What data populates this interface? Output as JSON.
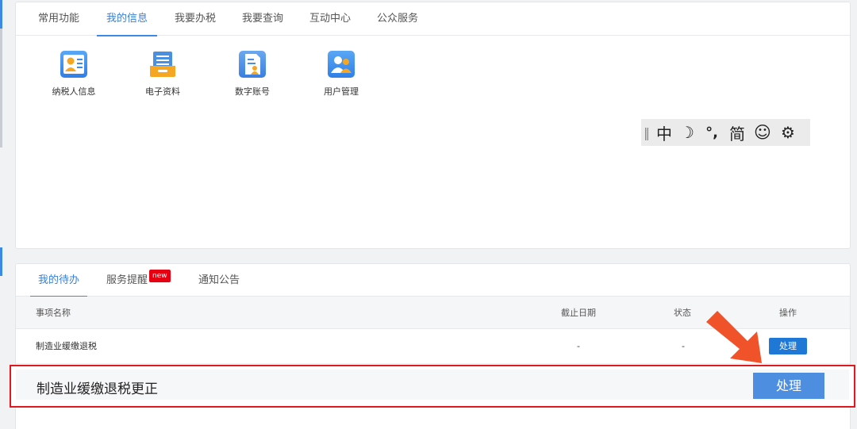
{
  "top_tabs": [
    {
      "label": "常用功能",
      "active": false
    },
    {
      "label": "我的信息",
      "active": true
    },
    {
      "label": "我要办税",
      "active": false
    },
    {
      "label": "我要查询",
      "active": false
    },
    {
      "label": "互动中心",
      "active": false
    },
    {
      "label": "公众服务",
      "active": false
    }
  ],
  "apps": [
    {
      "label": "纳税人信息",
      "icon": "taxpayer-id-card-icon",
      "color": "#3b8df0"
    },
    {
      "label": "电子资料",
      "icon": "document-stack-icon",
      "color": "#f5a623"
    },
    {
      "label": "数字账号",
      "icon": "digital-account-icon",
      "color": "#4a90e2"
    },
    {
      "label": "用户管理",
      "icon": "user-group-icon",
      "color": "#3b8df0"
    }
  ],
  "ime_toolbar": {
    "mode": "中",
    "moon": "☽",
    "punct": "°,",
    "simp": "简",
    "smile": "☺",
    "gear": "⚙"
  },
  "bottom_tabs": [
    {
      "label": "我的待办",
      "active": true
    },
    {
      "label": "服务提醒",
      "active": false,
      "badge": "new"
    },
    {
      "label": "通知公告",
      "active": false
    }
  ],
  "table": {
    "columns": [
      "事项名称",
      "截止日期",
      "状态",
      "操作"
    ],
    "rows": [
      {
        "name": "制造业缓缴退税",
        "deadline": "-",
        "status": "-",
        "action": "处理"
      }
    ]
  },
  "highlight": {
    "title": "制造业缓缴退税更正",
    "action": "处理"
  },
  "colors": {
    "accent": "#3d8ae6",
    "button": "#1f78d6",
    "highlight_border": "#e0191e",
    "arrow": "#f0522a",
    "badge": "#e60012"
  }
}
